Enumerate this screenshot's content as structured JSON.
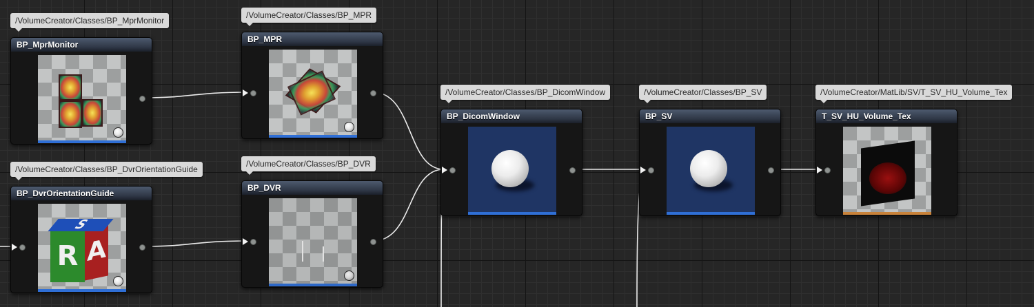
{
  "tooltips": {
    "mpr_monitor": "/VolumeCreator/Classes/BP_MprMonitor",
    "mpr": "/VolumeCreator/Classes/BP_MPR",
    "dvr_orientation": "/VolumeCreator/Classes/BP_DvrOrientationGuide",
    "dvr": "/VolumeCreator/Classes/BP_DVR",
    "dicom_window": "/VolumeCreator/Classes/BP_DicomWindow",
    "sv": "/VolumeCreator/Classes/BP_SV",
    "volume_tex": "/VolumeCreator/MatLib/SV/T_SV_HU_Volume_Tex"
  },
  "nodes": {
    "mpr_monitor": {
      "title": "BP_MprMonitor",
      "icon": "mri-monitor-thumbnail"
    },
    "mpr": {
      "title": "BP_MPR",
      "icon": "mpr-planes-thumbnail"
    },
    "dvr_orientation": {
      "title": "BP_DvrOrientationGuide",
      "icon": "orientation-cube-thumbnail",
      "cube_labels": {
        "top": "S",
        "front": "R",
        "side": "A"
      }
    },
    "dvr": {
      "title": "BP_DVR",
      "icon": "dvr-thumbnail"
    },
    "dicom_window": {
      "title": "BP_DicomWindow",
      "icon": "sphere-thumbnail"
    },
    "sv": {
      "title": "BP_SV",
      "icon": "sphere-thumbnail"
    },
    "volume_tex": {
      "title": "T_SV_HU_Volume_Tex",
      "icon": "volume-texture-thumbnail"
    }
  },
  "colors": {
    "blueprint_bar": "#2f6fd6",
    "texture_bar": "#c8823a",
    "wire": "#ebebeb",
    "node_bg": "#161616",
    "graph_bg": "#262626"
  }
}
